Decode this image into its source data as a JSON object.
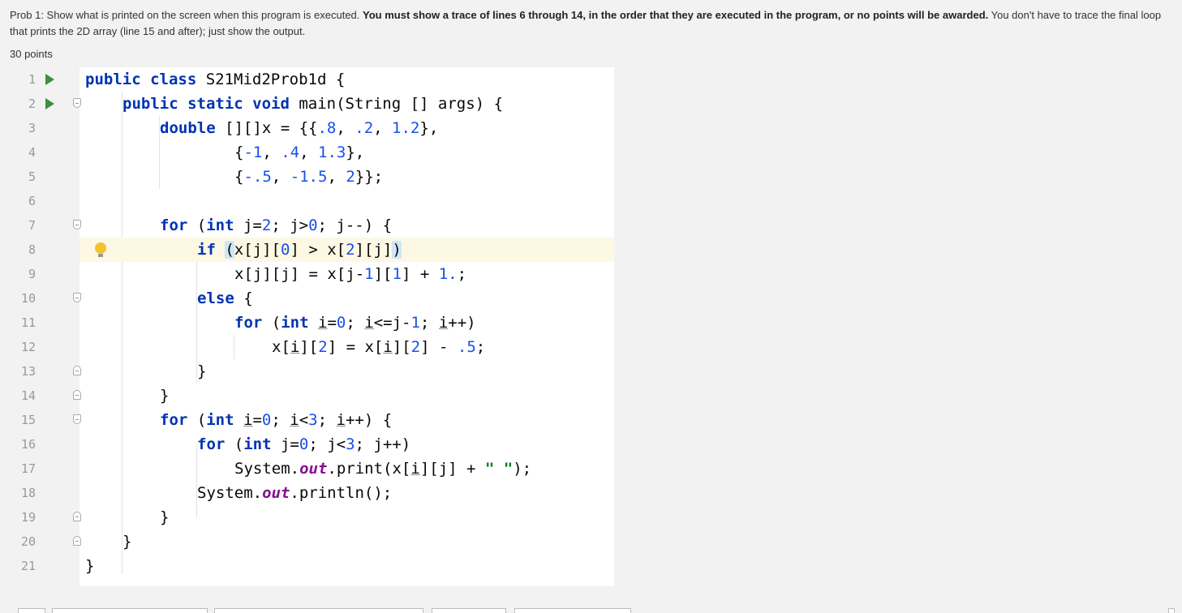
{
  "question": {
    "prefix": "Prob 1: Show what is printed on the screen when this program is executed. ",
    "bold": "You must show a trace of lines 6 through 14, in the order that they are executed in the program, or no points will be awarded.",
    "suffix": " You don't have to trace the final loop that prints the 2D array (line 15 and after); just show the output.",
    "points": "30 points"
  },
  "line_numbers": [
    "1",
    "2",
    "3",
    "4",
    "5",
    "6",
    "7",
    "8",
    "9",
    "10",
    "11",
    "12",
    "13",
    "14",
    "15",
    "16",
    "17",
    "18",
    "19",
    "20",
    "21"
  ],
  "code": {
    "l1": {
      "kw1": "public class",
      "rest": " S21Mid2Prob1d {"
    },
    "l2": {
      "kw1": "public static void",
      "rest": " main(String [] args) {"
    },
    "l3": {
      "kw1": "double",
      "rest": " [][]x = {{",
      "n1": ".8",
      "c1": ", ",
      "n2": ".2",
      "c2": ", ",
      "n3": "1.2",
      "tail": "},"
    },
    "l4": {
      "open": "{",
      "n1": "-1",
      "c1": ", ",
      "n2": ".4",
      "c2": ", ",
      "n3": "1.3",
      "tail": "},"
    },
    "l5": {
      "open": "{",
      "n1": "-.5",
      "c1": ", ",
      "n2": "-1.5",
      "c2": ", ",
      "n3": "2",
      "tail": "}};"
    },
    "l7": {
      "kw1": "for",
      "a": " (",
      "kw2": "int",
      "b": " j=",
      "n1": "2",
      "c": "; j>",
      "n2": "0",
      "d": "; j--) {"
    },
    "l8": {
      "kw1": "if",
      "a": " ",
      "sel_open": "(",
      "b": "x[j][",
      "n1": "0",
      "c": "] > x[",
      "n2": "2",
      "d": "][j]",
      "sel_close": ")"
    },
    "l9": {
      "a": "x[j][j] = x[j-",
      "n1": "1",
      "b": "][",
      "n2": "1",
      "c": "] + ",
      "n3": "1.",
      "d": ";"
    },
    "l10": {
      "kw1": "else",
      "rest": " {"
    },
    "l11": {
      "kw1": "for",
      "a": " (",
      "kw2": "int",
      "b": " ",
      "u1": "i",
      "c": "=",
      "n1": "0",
      "d": "; ",
      "u2": "i",
      "e": "<=j-",
      "n2": "1",
      "f": "; ",
      "u3": "i",
      "g": "++)"
    },
    "l12": {
      "a": "x[",
      "u1": "i",
      "b": "][",
      "n1": "2",
      "c": "] = x[",
      "u2": "i",
      "d": "][",
      "n2": "2",
      "e": "] - ",
      "n3": ".5",
      "f": ";"
    },
    "l13": {
      "rest": "}"
    },
    "l14": {
      "rest": "}"
    },
    "l15": {
      "kw1": "for",
      "a": " (",
      "kw2": "int",
      "b": " ",
      "u1": "i",
      "c": "=",
      "n1": "0",
      "d": "; ",
      "u2": "i",
      "e": "<",
      "n2": "3",
      "f": "; ",
      "u3": "i",
      "g": "++) {"
    },
    "l16": {
      "kw1": "for",
      "a": " (",
      "kw2": "int",
      "b": " j=",
      "n1": "0",
      "c": "; j<",
      "n2": "3",
      "d": "; j++)"
    },
    "l17": {
      "a": "System.",
      "fld": "out",
      "b": ".print(x[",
      "u1": "i",
      "c": "][j] + ",
      "str": "\" \"",
      "d": ");"
    },
    "l18": {
      "a": "System.",
      "fld": "out",
      "b": ".println();"
    },
    "l19": {
      "rest": "}"
    },
    "l20": {
      "rest": "}"
    },
    "l21": {
      "rest": "}"
    }
  },
  "colors": {
    "keyword": "#0033b3",
    "number": "#1750eb",
    "field": "#871094",
    "string": "#067d17",
    "highlight": "#fdf8e3"
  }
}
